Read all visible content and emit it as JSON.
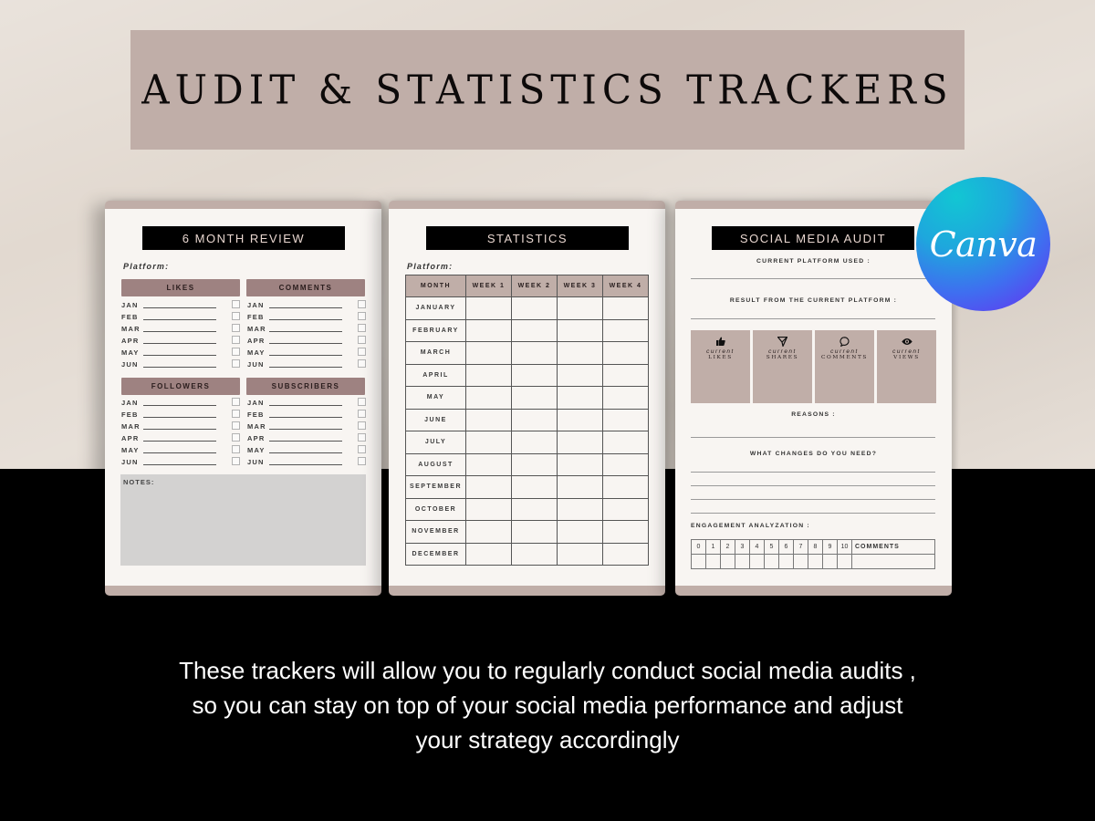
{
  "banner": {
    "title": "AUDIT & STATISTICS TRACKERS"
  },
  "page1": {
    "title": "6 MONTH REVIEW",
    "platform_label": "Platform:",
    "sections": [
      {
        "header": "LIKES",
        "months": [
          "JAN",
          "FEB",
          "MAR",
          "APR",
          "MAY",
          "JUN"
        ]
      },
      {
        "header": "COMMENTS",
        "months": [
          "JAN",
          "FEB",
          "MAR",
          "APR",
          "MAY",
          "JUN"
        ]
      },
      {
        "header": "FOLLOWERS",
        "months": [
          "JAN",
          "FEB",
          "MAR",
          "APR",
          "MAY",
          "JUN"
        ]
      },
      {
        "header": "SUBSCRIBERS",
        "months": [
          "JAN",
          "FEB",
          "MAR",
          "APR",
          "MAY",
          "JUN"
        ]
      }
    ],
    "notes_label": "NOTES:"
  },
  "page2": {
    "title": "STATISTICS",
    "platform_label": "Platform:",
    "columns": [
      "MONTH",
      "WEEK 1",
      "WEEK 2",
      "WEEK 3",
      "WEEK 4"
    ],
    "rows": [
      "JANUARY",
      "FEBRUARY",
      "MARCH",
      "APRIL",
      "MAY",
      "JUNE",
      "JULY",
      "AUGUST",
      "SEPTEMBER",
      "OCTOBER",
      "NOVEMBER",
      "DECEMBER"
    ]
  },
  "page3": {
    "title": "SOCIAL MEDIA AUDIT",
    "current_platform_label": "CURRENT PLATFORM USED :",
    "result_label": "RESULT FROM THE CURRENT PLATFORM :",
    "metrics": [
      {
        "icon": "thumbs-up-icon",
        "current": "current",
        "name": "LIKES"
      },
      {
        "icon": "send-icon",
        "current": "current",
        "name": "SHARES"
      },
      {
        "icon": "speech-bubble-icon",
        "current": "current",
        "name": "COMMENTS"
      },
      {
        "icon": "eye-icon",
        "current": "current",
        "name": "VIEWS"
      }
    ],
    "reasons_label": "REASONS :",
    "changes_label": "WHAT CHANGES DO YOU NEED?",
    "engagement_label": "ENGAGEMENT ANALYZATION :",
    "engagement_scale": [
      "0",
      "1",
      "2",
      "3",
      "4",
      "5",
      "6",
      "7",
      "8",
      "9",
      "10"
    ],
    "engagement_comments": "COMMENTS"
  },
  "badge": {
    "text": "Canva"
  },
  "caption": {
    "lines": [
      "These trackers will allow you to regularly conduct social media audits ,",
      "so you can stay on top of your social media performance and adjust",
      "your strategy accordingly"
    ]
  },
  "colors": {
    "accent_rose": "#c0aea8",
    "section_header": "#9e8281",
    "page_bg": "#f8f5f2",
    "notes_bg": "#d3d2d1"
  }
}
